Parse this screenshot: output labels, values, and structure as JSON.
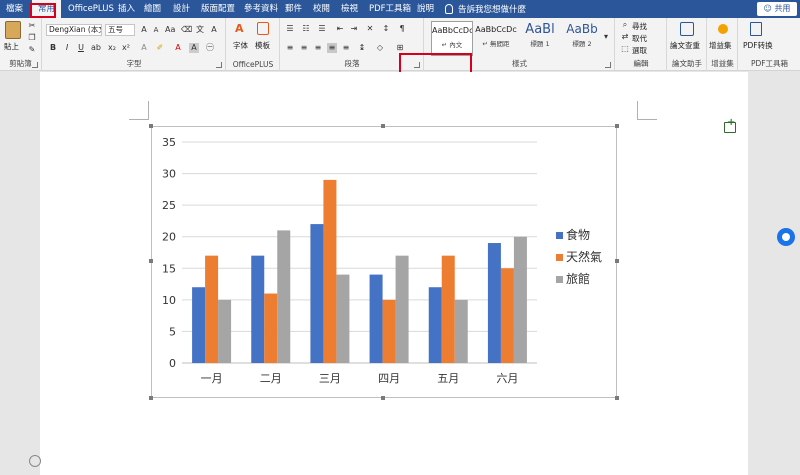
{
  "menubar": {
    "tabs": [
      "檔案",
      "常用",
      "OfficePLUS",
      "插入",
      "繪圖",
      "設計",
      "版面配置",
      "參考資料",
      "郵件",
      "校閱",
      "檢視",
      "PDF工具箱",
      "說明"
    ],
    "search_placeholder": "告訴我您想做什麼",
    "share_label": "共用"
  },
  "ribbon": {
    "clipboard": {
      "paste_label": "貼上",
      "group_label": "剪貼簿"
    },
    "font": {
      "font_name": "DengXian (本文)",
      "font_size": "五号",
      "bold": "B",
      "italic": "I",
      "underline": "U",
      "font_color": "A",
      "group_label": "字型"
    },
    "officeplus": {
      "font_label": "字体",
      "template_label": "模板",
      "group_label": "OfficePLUS"
    },
    "paragraph": {
      "group_label": "段落"
    },
    "styles": {
      "items": [
        {
          "sample": "AaBbCcDc",
          "name": "↵ 內文"
        },
        {
          "sample": "AaBbCcDc",
          "name": "↵ 無間距"
        },
        {
          "sample": "AaBl",
          "name": "標題 1"
        },
        {
          "sample": "AaBb",
          "name": "標題 2"
        }
      ],
      "group_label": "樣式"
    },
    "editing": {
      "find_label": "尋找",
      "replace_label": "取代",
      "select_label": "選取",
      "group_label": "編輯"
    },
    "assistant": {
      "check_label": "論文查重",
      "group_label": "論文助手"
    },
    "addins": {
      "label": "增益集",
      "group_label": "增益集"
    },
    "pdf": {
      "label": "PDF转换",
      "group_label": "PDF工具箱"
    }
  },
  "chart_data": {
    "type": "bar",
    "categories": [
      "一月",
      "二月",
      "三月",
      "四月",
      "五月",
      "六月"
    ],
    "series": [
      {
        "name": "食物",
        "values": [
          12,
          17,
          22,
          14,
          12,
          19
        ],
        "color": "#4472c4"
      },
      {
        "name": "天然氣",
        "values": [
          17,
          11,
          29,
          10,
          17,
          15
        ],
        "color": "#ed7d31"
      },
      {
        "name": "旅館",
        "values": [
          10,
          21,
          14,
          17,
          10,
          20
        ],
        "color": "#a5a5a5"
      }
    ],
    "yticks": [
      "0",
      "5",
      "10",
      "15",
      "20",
      "25",
      "30",
      "35"
    ],
    "ylim": [
      0,
      35
    ],
    "grid": true,
    "legend_position": "right"
  }
}
